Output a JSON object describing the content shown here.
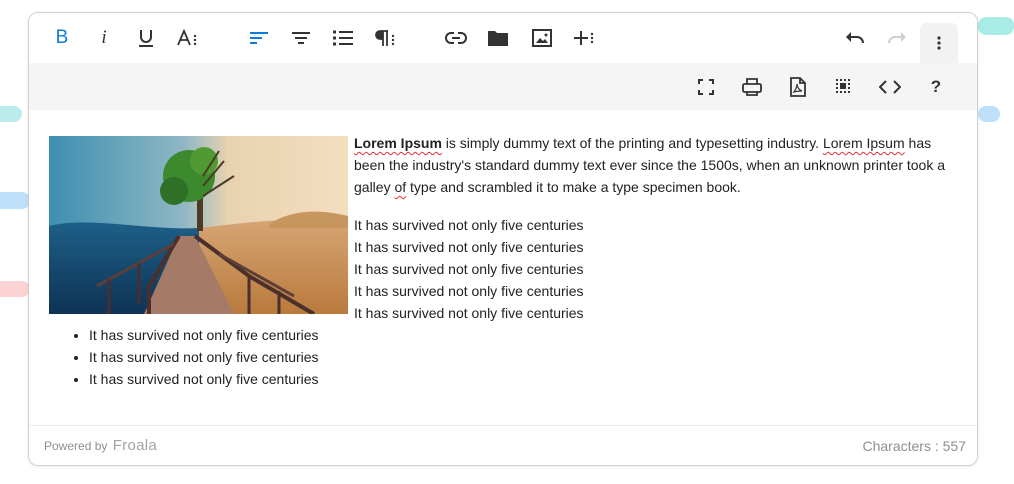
{
  "toolbar": {
    "primary": [
      {
        "name": "bold-button",
        "icon": "bold-icon",
        "glyph": "B",
        "active": true
      },
      {
        "name": "italic-button",
        "icon": "italic-icon",
        "glyph": "i"
      },
      {
        "name": "underline-button",
        "icon": "underline-icon"
      },
      {
        "name": "text-format-more-button",
        "icon": "font-more-icon"
      },
      {
        "name": "align-left-button",
        "icon": "align-left-icon",
        "active": true
      },
      {
        "name": "align-center-button",
        "icon": "align-center-icon"
      },
      {
        "name": "ordered-list-button",
        "icon": "ordered-list-icon"
      },
      {
        "name": "paragraph-more-button",
        "icon": "paragraph-more-icon"
      },
      {
        "name": "insert-link-button",
        "icon": "link-icon"
      },
      {
        "name": "insert-file-button",
        "icon": "folder-icon"
      },
      {
        "name": "insert-image-button",
        "icon": "image-icon"
      },
      {
        "name": "insert-more-button",
        "icon": "plus-more-icon"
      },
      {
        "name": "undo-button",
        "icon": "undo-icon"
      },
      {
        "name": "redo-button",
        "icon": "redo-icon",
        "disabled": true
      },
      {
        "name": "more-options-button",
        "icon": "vertical-dots-icon"
      }
    ],
    "secondary": [
      {
        "name": "fullscreen-button",
        "icon": "fullscreen-icon"
      },
      {
        "name": "print-button",
        "icon": "print-icon"
      },
      {
        "name": "export-pdf-button",
        "icon": "pdf-icon"
      },
      {
        "name": "select-all-button",
        "icon": "select-all-icon"
      },
      {
        "name": "code-view-button",
        "icon": "code-icon"
      },
      {
        "name": "help-button",
        "icon": "help-icon",
        "glyph": "?"
      }
    ],
    "accent_color": "#0d7bd9"
  },
  "content": {
    "image_alt": "Wooden boardwalk over sea with half-green half-bare tree and desert",
    "intro_bold": "Lorem Ipsum",
    "intro_part1": " is simply dummy text of the printing and typesetting industry. ",
    "intro_spell": "Lorem Ipsum",
    "intro_part2": " has been the industry's standard dummy text ever since the 1500s, when an unknown printer took a galley ",
    "intro_of": "of",
    "intro_part3": " type and scrambled it to make a type specimen book.",
    "lines": [
      "It has survived not only five centuries",
      "It has survived not only five centuries",
      "It has survived not only five centuries",
      "It has survived not only five centuries",
      "It has survived not only five centuries"
    ],
    "bullets": [
      "It has survived not only five centuries",
      "It has survived not only five centuries",
      "It has survived not only five centuries"
    ]
  },
  "footer": {
    "powered_by": "Powered by",
    "brand": "Froala",
    "characters": "Characters : 557"
  }
}
